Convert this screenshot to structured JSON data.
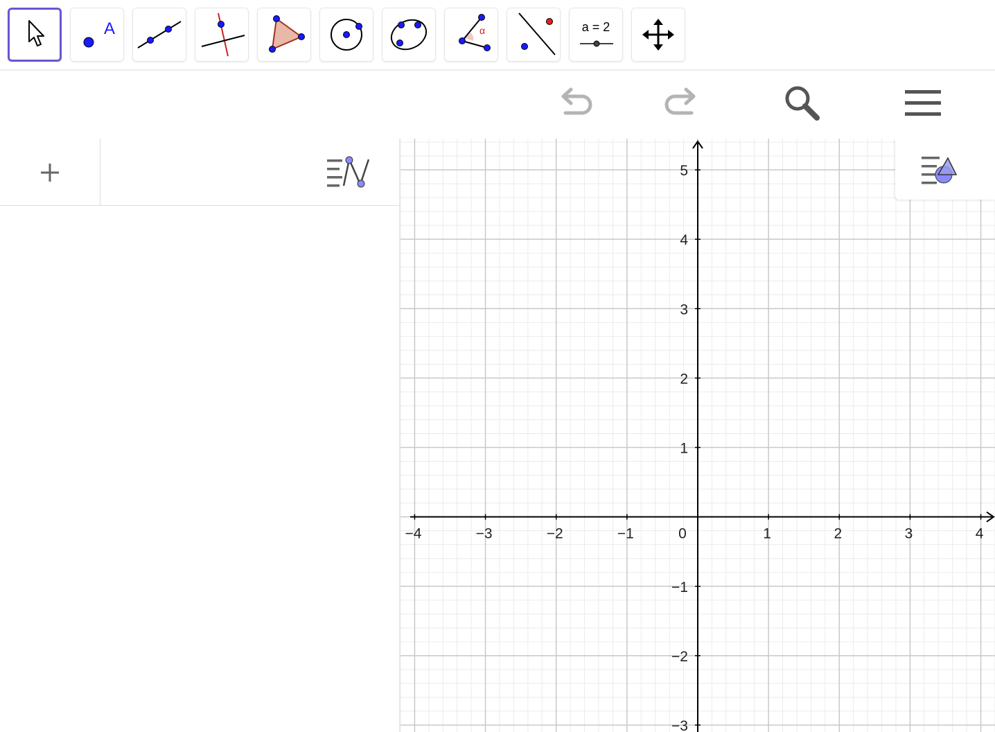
{
  "toolbar": {
    "tools": [
      {
        "name": "move-tool",
        "icon": "arrow-cursor-icon",
        "active": true
      },
      {
        "name": "point-tool",
        "icon": "point-icon",
        "label": "A"
      },
      {
        "name": "line-tool",
        "icon": "line-icon"
      },
      {
        "name": "perpendicular-line-tool",
        "icon": "perpendicular-line-icon"
      },
      {
        "name": "polygon-tool",
        "icon": "polygon-icon"
      },
      {
        "name": "circle-center-point-tool",
        "icon": "circle-icon"
      },
      {
        "name": "conic-through-points-tool",
        "icon": "ellipse-icon"
      },
      {
        "name": "angle-tool",
        "icon": "angle-icon",
        "label": "α"
      },
      {
        "name": "reflect-tool",
        "icon": "reflect-icon"
      },
      {
        "name": "slider-tool",
        "icon": "slider-icon",
        "label": "a = 2"
      },
      {
        "name": "move-graphics-view-tool",
        "icon": "move-arrows-icon"
      }
    ]
  },
  "header": {
    "undo": {
      "icon": "undo-icon"
    },
    "redo": {
      "icon": "redo-icon"
    },
    "search": {
      "icon": "search-icon"
    },
    "menu": {
      "icon": "hamburger-menu-icon"
    }
  },
  "algebra": {
    "add_symbol": "+",
    "style_icon": "algebra-style-icon"
  },
  "graphics": {
    "style_icon": "graphics-style-icon",
    "axes": {
      "x_range": [
        -4.2,
        4.2
      ],
      "y_range": [
        -3.1,
        5.45
      ],
      "x_ticks": [
        -4,
        -3,
        -2,
        -1,
        0,
        1,
        2,
        3,
        4
      ],
      "y_ticks": [
        -3,
        -2,
        -1,
        1,
        2,
        3,
        4,
        5
      ],
      "x_labels": [
        "−4",
        "−3",
        "−2",
        "−1",
        "0",
        "1",
        "2",
        "3",
        "4"
      ],
      "y_labels": [
        "−3",
        "−2",
        "−1",
        "1",
        "2",
        "3",
        "4",
        "5"
      ],
      "grid": true,
      "minor_grid_per_unit": 5
    },
    "colors": {
      "major_grid": "#c8c8c8",
      "minor_grid": "#ebebeb",
      "axis": "#000000"
    }
  },
  "colors": {
    "accent": "#6557d2",
    "point": "#1a1aff",
    "polygon_fill": "#e8b8a8",
    "red": "#e02020",
    "icon_gray": "#666666"
  }
}
